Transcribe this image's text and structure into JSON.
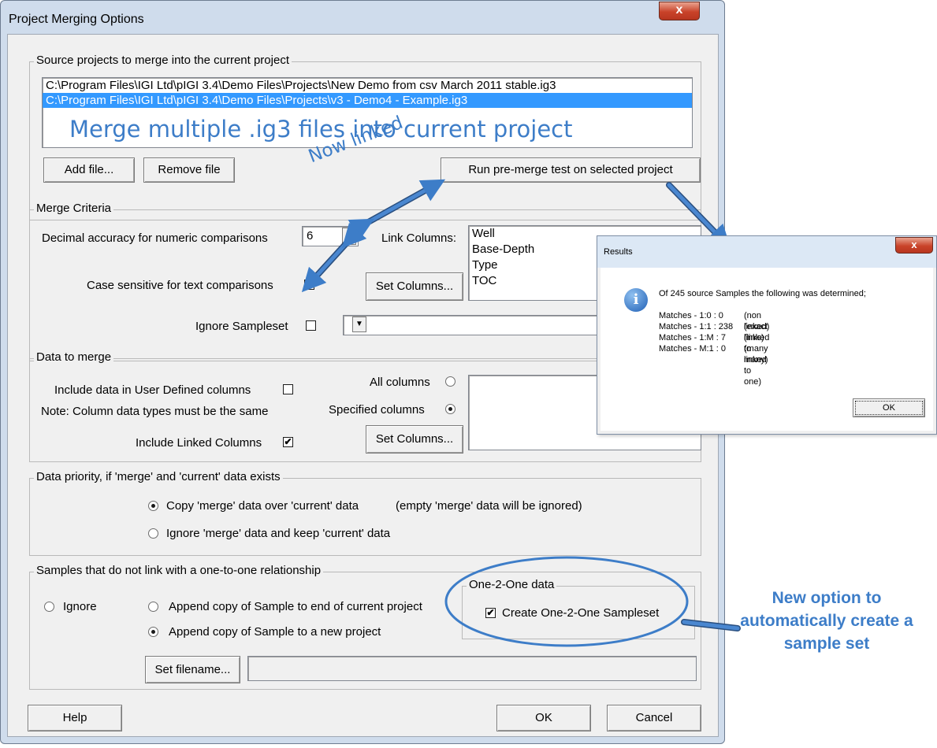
{
  "dialog": {
    "title": "Project Merging Options",
    "close_glyph": "x"
  },
  "source": {
    "legend": "Source projects to merge into the current project",
    "files": [
      "C:\\Program Files\\IGI Ltd\\pIGI 3.4\\Demo Files\\Projects\\New Demo from csv March 2011 stable.ig3",
      "C:\\Program Files\\IGI Ltd\\pIGI 3.4\\Demo Files\\Projects\\v3 - Demo4 - Example.ig3"
    ],
    "add_file": "Add file...",
    "remove_file": "Remove file",
    "run_test": "Run pre-merge test on selected project"
  },
  "criteria": {
    "legend": "Merge Criteria",
    "decimal_label": "Decimal accuracy for numeric comparisons",
    "decimal_value": "6",
    "case_label": "Case sensitive for text comparisons",
    "case_checked": true,
    "link_label": "Link Columns:",
    "link_columns": [
      "Well",
      "Base-Depth",
      "Type",
      "TOC"
    ],
    "set_columns": "Set Columns...",
    "ignore_sampleset_label": "Ignore Sampleset"
  },
  "data_merge": {
    "legend": "Data to merge",
    "include_user_defined": "Include data in User Defined columns",
    "note": "Note: Column data types must be the same",
    "include_linked": "Include Linked Columns",
    "all_columns": "All columns",
    "specified_columns": "Specified columns",
    "set_columns": "Set Columns..."
  },
  "priority": {
    "legend": "Data priority, if 'merge' and 'current' data exists",
    "copy_option": "Copy 'merge' data over 'current' data",
    "copy_note": "(empty 'merge' data will be ignored)",
    "ignore_option": "Ignore 'merge' data and keep 'current' data"
  },
  "samples": {
    "legend": "Samples that do not link with a one-to-one relationship",
    "ignore": "Ignore",
    "append_end": "Append copy of Sample to end of current project",
    "append_new": "Append copy of Sample to a new project",
    "set_filename": "Set filename...",
    "one2one_legend": "One-2-One data",
    "create_one2one": "Create One-2-One Sampleset"
  },
  "footer": {
    "help": "Help",
    "ok": "OK",
    "cancel": "Cancel"
  },
  "results": {
    "title": "Results",
    "close_glyph": "x",
    "info_icon": "i",
    "message": "Of 245 source Samples the following was determined;",
    "rows": [
      {
        "label": "Matches - 1:0 : 0",
        "note": "(non linked)"
      },
      {
        "label": "Matches - 1:1 : 238",
        "note": "(exact links)"
      },
      {
        "label": "Matches - 1:M : 7",
        "note": "(linked to many)"
      },
      {
        "label": "Matches - M:1 : 0",
        "note": "(many linked to one)"
      }
    ],
    "ok": "OK"
  },
  "annotations": {
    "merge_multiple": "Merge multiple .ig3 files into current project",
    "now_linked": "Now linked",
    "new_option": "New option to automatically create a sample set",
    "color": "#3d7dc8"
  },
  "icons": {
    "checked_glyph": "✔",
    "dropdown_glyph": "▼"
  }
}
